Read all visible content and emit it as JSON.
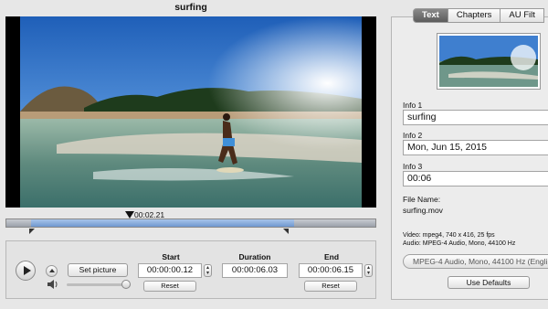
{
  "window": {
    "title": "surfing"
  },
  "player": {
    "timecode": "00:02.21"
  },
  "controls": {
    "set_picture_label": "Set picture",
    "start": {
      "label": "Start",
      "value": "00:00:00.12",
      "reset_label": "Reset"
    },
    "duration": {
      "label": "Duration",
      "value": "00:00:06.03"
    },
    "end": {
      "label": "End",
      "value": "00:00:06.15",
      "reset_label": "Reset"
    }
  },
  "sidebar": {
    "tabs": [
      {
        "label": "Text",
        "active": true
      },
      {
        "label": "Chapters",
        "active": false
      },
      {
        "label": "AU Filt",
        "active": false
      }
    ],
    "info1": {
      "label": "Info 1",
      "value": "surfing"
    },
    "info2": {
      "label": "Info 2",
      "value": "Mon, Jun 15, 2015"
    },
    "info3": {
      "label": "Info 3",
      "value": "00:06"
    },
    "file_name_label": "File Name:",
    "file_name": "surfing.mov",
    "video_info": "Video: mpeg4, 740 x 416, 25 fps",
    "audio_info": "Audio: MPEG-4 Audio, Mono, 44100 Hz",
    "audio_select": "MPEG-4 Audio, Mono, 44100 Hz (Engli",
    "use_defaults_label": "Use Defaults"
  },
  "colors": {
    "selection": "#7ba1d6",
    "active_tab": "#6e6e6e"
  },
  "icons": [
    "play-icon",
    "eject-icon",
    "speaker-icon",
    "playhead-icon"
  ]
}
